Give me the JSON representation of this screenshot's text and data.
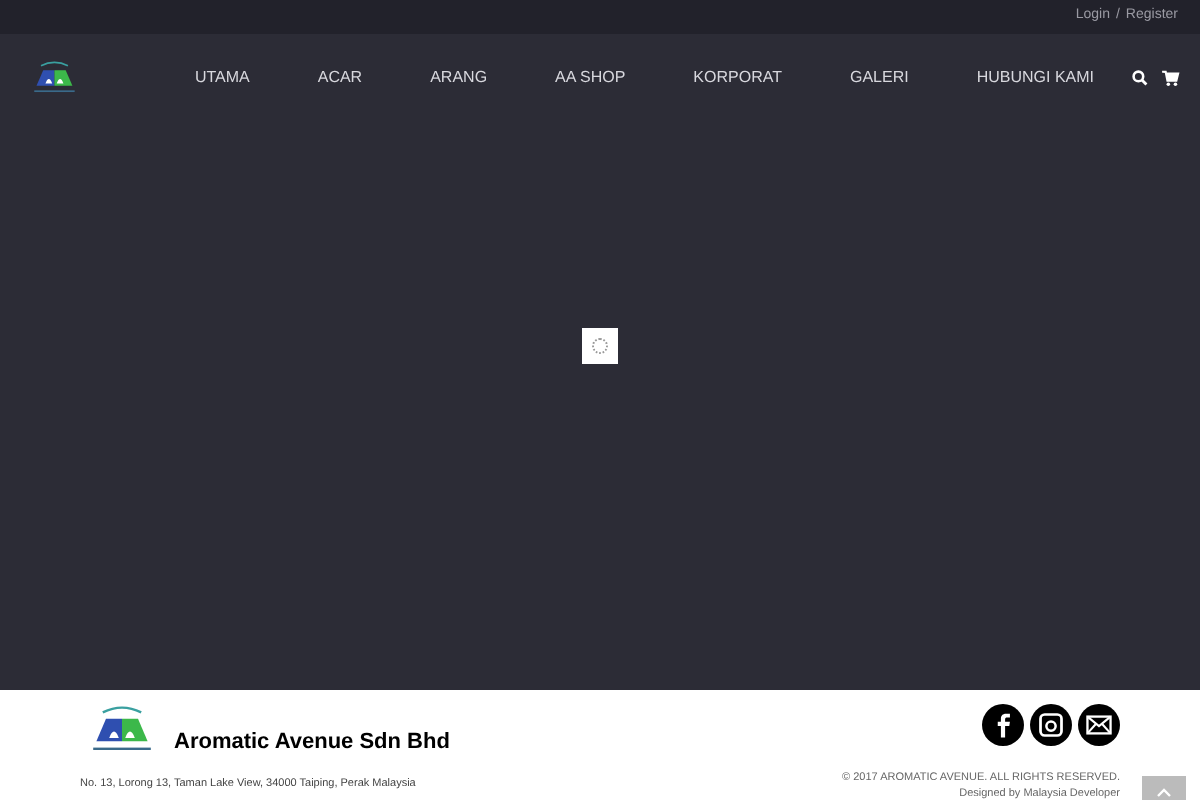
{
  "top_bar": {
    "login": "Login",
    "separator": "/",
    "register": "Register"
  },
  "nav": {
    "items": [
      {
        "label": "UTAMA"
      },
      {
        "label": "ACAR"
      },
      {
        "label": "ARANG"
      },
      {
        "label": "AA SHOP"
      },
      {
        "label": "KORPORAT"
      },
      {
        "label": "GALERI"
      },
      {
        "label": "HUBUNGI KAMI"
      }
    ]
  },
  "footer": {
    "company": "Aromatic Avenue Sdn Bhd",
    "address": "No. 13, Lorong 13, Taman Lake View, 34000 Taiping, Perak Malaysia",
    "copyright": "© 2017 AROMATIC AVENUE. ALL RIGHTS RESERVED.",
    "designed_by": "Designed by Malaysia Developer"
  }
}
